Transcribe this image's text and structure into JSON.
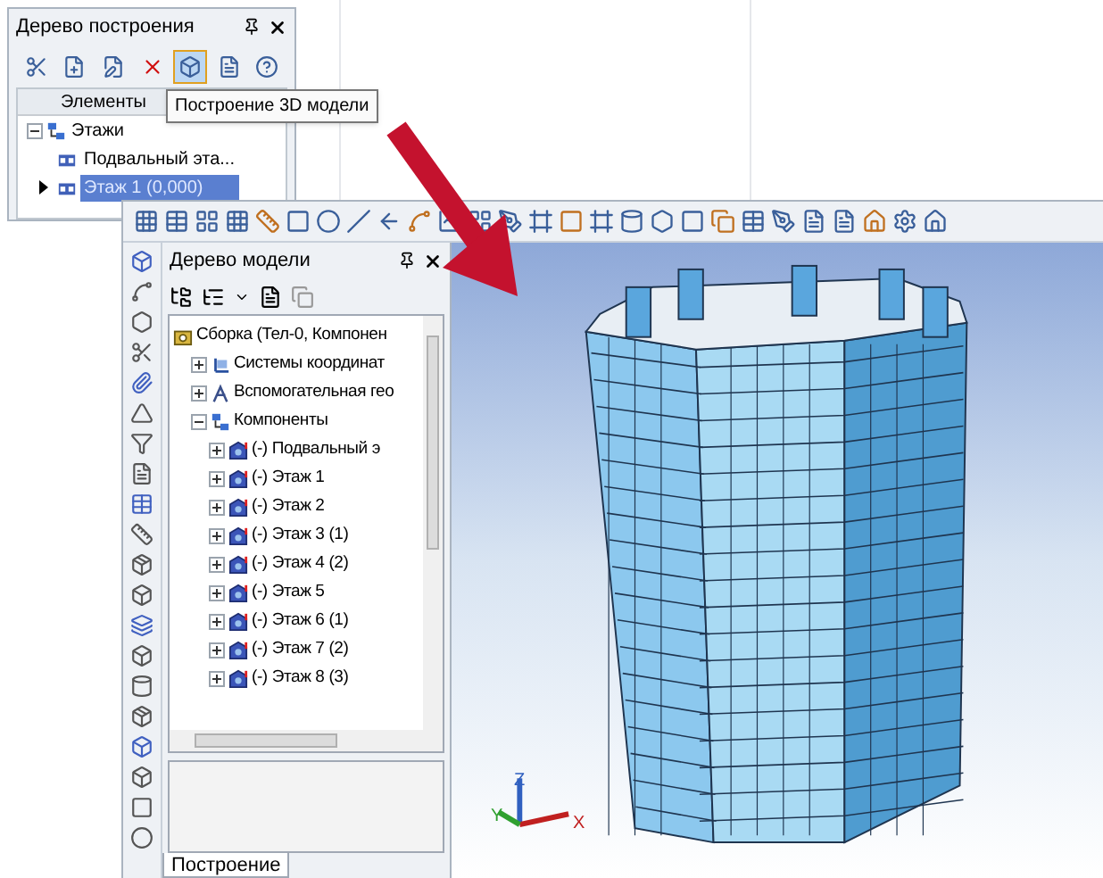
{
  "build_tree": {
    "title": "Дерево построения",
    "toolbar": [
      {
        "pressed": false
      },
      {
        "pressed": false
      },
      {
        "pressed": false
      },
      {
        "pressed": false
      },
      {
        "pressed": true
      },
      {
        "pressed": false
      },
      {
        "pressed": false
      }
    ],
    "tooltip": "Построение 3D модели",
    "column": "Элементы",
    "items": [
      {
        "label": "Этажи",
        "kind": "group",
        "expanded": true,
        "selected": false,
        "children": [
          {
            "label": "Подвальный эта...",
            "kind": "floor",
            "selected": false
          },
          {
            "label": "Этаж 1 (0,000)",
            "kind": "floor",
            "selected": true
          }
        ]
      }
    ]
  },
  "model_tree": {
    "title": "Дерево модели",
    "root": {
      "label": "Сборка (Тел-0, Компонен",
      "kind": "assembly",
      "children": [
        {
          "label": "Системы координат",
          "kind": "csys",
          "expanded": false
        },
        {
          "label": "Вспомогательная гео",
          "kind": "aux",
          "expanded": false
        },
        {
          "label": "Компоненты",
          "kind": "group",
          "expanded": true,
          "children": [
            {
              "label": "(-) Подвальный э",
              "kind": "part",
              "expanded": false
            },
            {
              "label": "(-) Этаж 1",
              "kind": "part",
              "expanded": false
            },
            {
              "label": "(-) Этаж 2",
              "kind": "part",
              "expanded": false
            },
            {
              "label": "(-) Этаж 3 (1)",
              "kind": "part",
              "expanded": false
            },
            {
              "label": "(-) Этаж 4 (2)",
              "kind": "part",
              "expanded": false
            },
            {
              "label": "(-) Этаж 5",
              "kind": "part",
              "expanded": false
            },
            {
              "label": "(-) Этаж 6 (1)",
              "kind": "part",
              "expanded": false
            },
            {
              "label": "(-) Этаж 7 (2)",
              "kind": "part",
              "expanded": false
            },
            {
              "label": "(-) Этаж 8 (3)",
              "kind": "part",
              "expanded": false
            }
          ]
        }
      ]
    },
    "tab": "Построение"
  },
  "viewport": {
    "axes": {
      "x": "X",
      "y": "Y",
      "z": "Z"
    }
  }
}
